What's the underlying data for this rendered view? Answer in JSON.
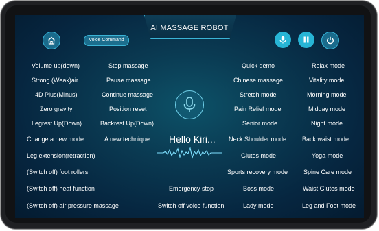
{
  "header": {
    "title": "AI MASSAGE ROBOT",
    "voice_command_label": "Voice Command"
  },
  "icons": {
    "home": "home-icon",
    "mic": "microphone-icon",
    "pause": "pause-icon",
    "power": "power-icon",
    "center_mic": "microphone-icon",
    "wave": "sound-wave-icon"
  },
  "center": {
    "greeting": "Hello Kiri..."
  },
  "col1": [
    "Volume up(down)",
    "Strong (Weak)air",
    "4D Plus(Minus)",
    "Zero gravity",
    "Legrest Up(Down)",
    "Change a new mode",
    "Leg extension(retraction)",
    "(Switch off) foot rollers",
    "(Switch off) heat function",
    "(Switch off) air pressure massage"
  ],
  "col2": [
    "Stop massage",
    "Pause massage",
    "Continue massage",
    "Position reset",
    "Backrest Up(Down)",
    "A new technique"
  ],
  "bottom_center": [
    "Emergency stop",
    "Switch off voice function"
  ],
  "col3": [
    "Quick demo",
    "Chinese massage",
    "Stretch mode",
    "Pain Relief mode",
    "Senior mode",
    "Neck Shoulder mode",
    "Glutes mode",
    "Sports recovery mode",
    "Boss mode",
    "Lady mode"
  ],
  "col4": [
    "Relax mode",
    "Vitality mode",
    "Morning mode",
    "Midday mode",
    "Night mode",
    "Back waist mode",
    "Yoga mode",
    "Spine Care mode",
    "Waist Glutes mode",
    "Leg and Foot mode"
  ],
  "colors": {
    "accent": "#27b5d6",
    "background": "#0a3a52",
    "text": "#ffffff"
  }
}
